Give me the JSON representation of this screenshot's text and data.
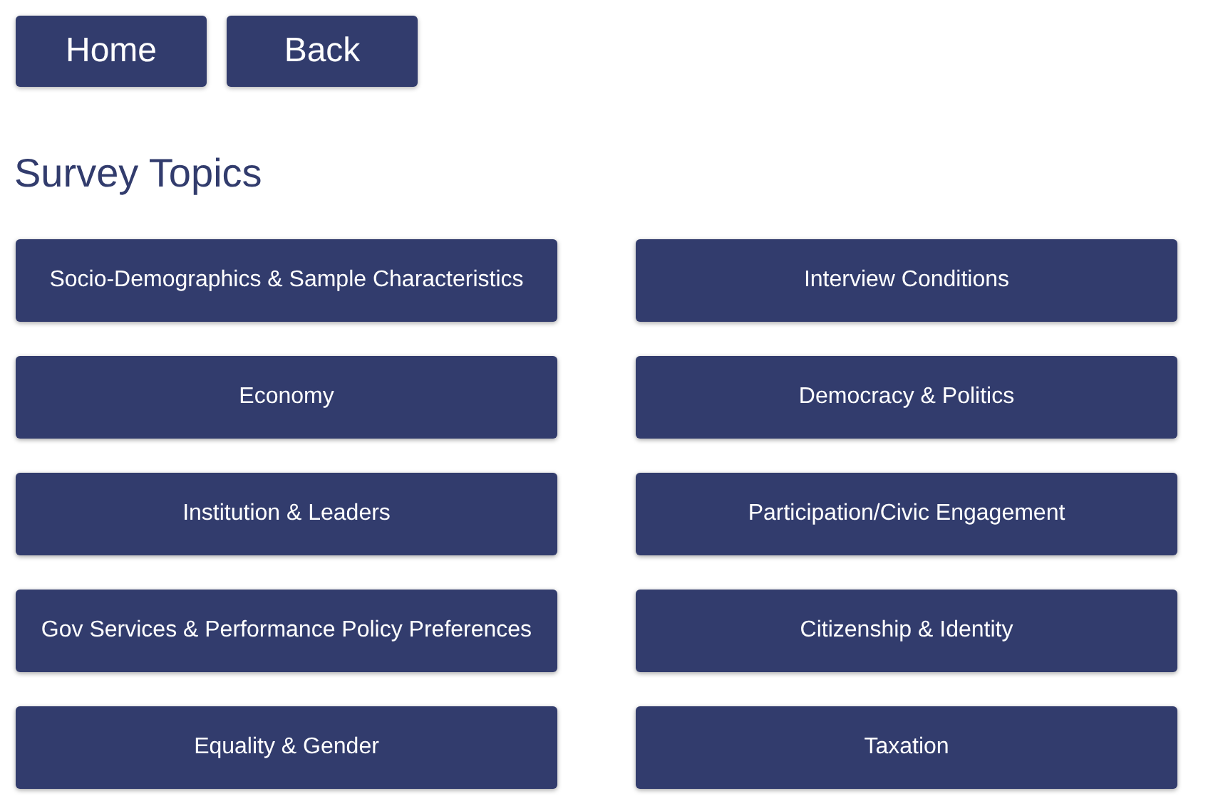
{
  "nav_buttons": [
    "Home",
    "Back"
  ],
  "title": "Survey Topics",
  "topics": [
    "Socio-Demographics & Sample Characteristics",
    "Interview Conditions",
    "Economy",
    "Democracy & Politics",
    "Institution & Leaders",
    "Participation/Civic Engagement",
    "Gov Services & Performance Policy Preferences",
    "Citizenship & Identity",
    "Equality & Gender",
    "Taxation"
  ]
}
